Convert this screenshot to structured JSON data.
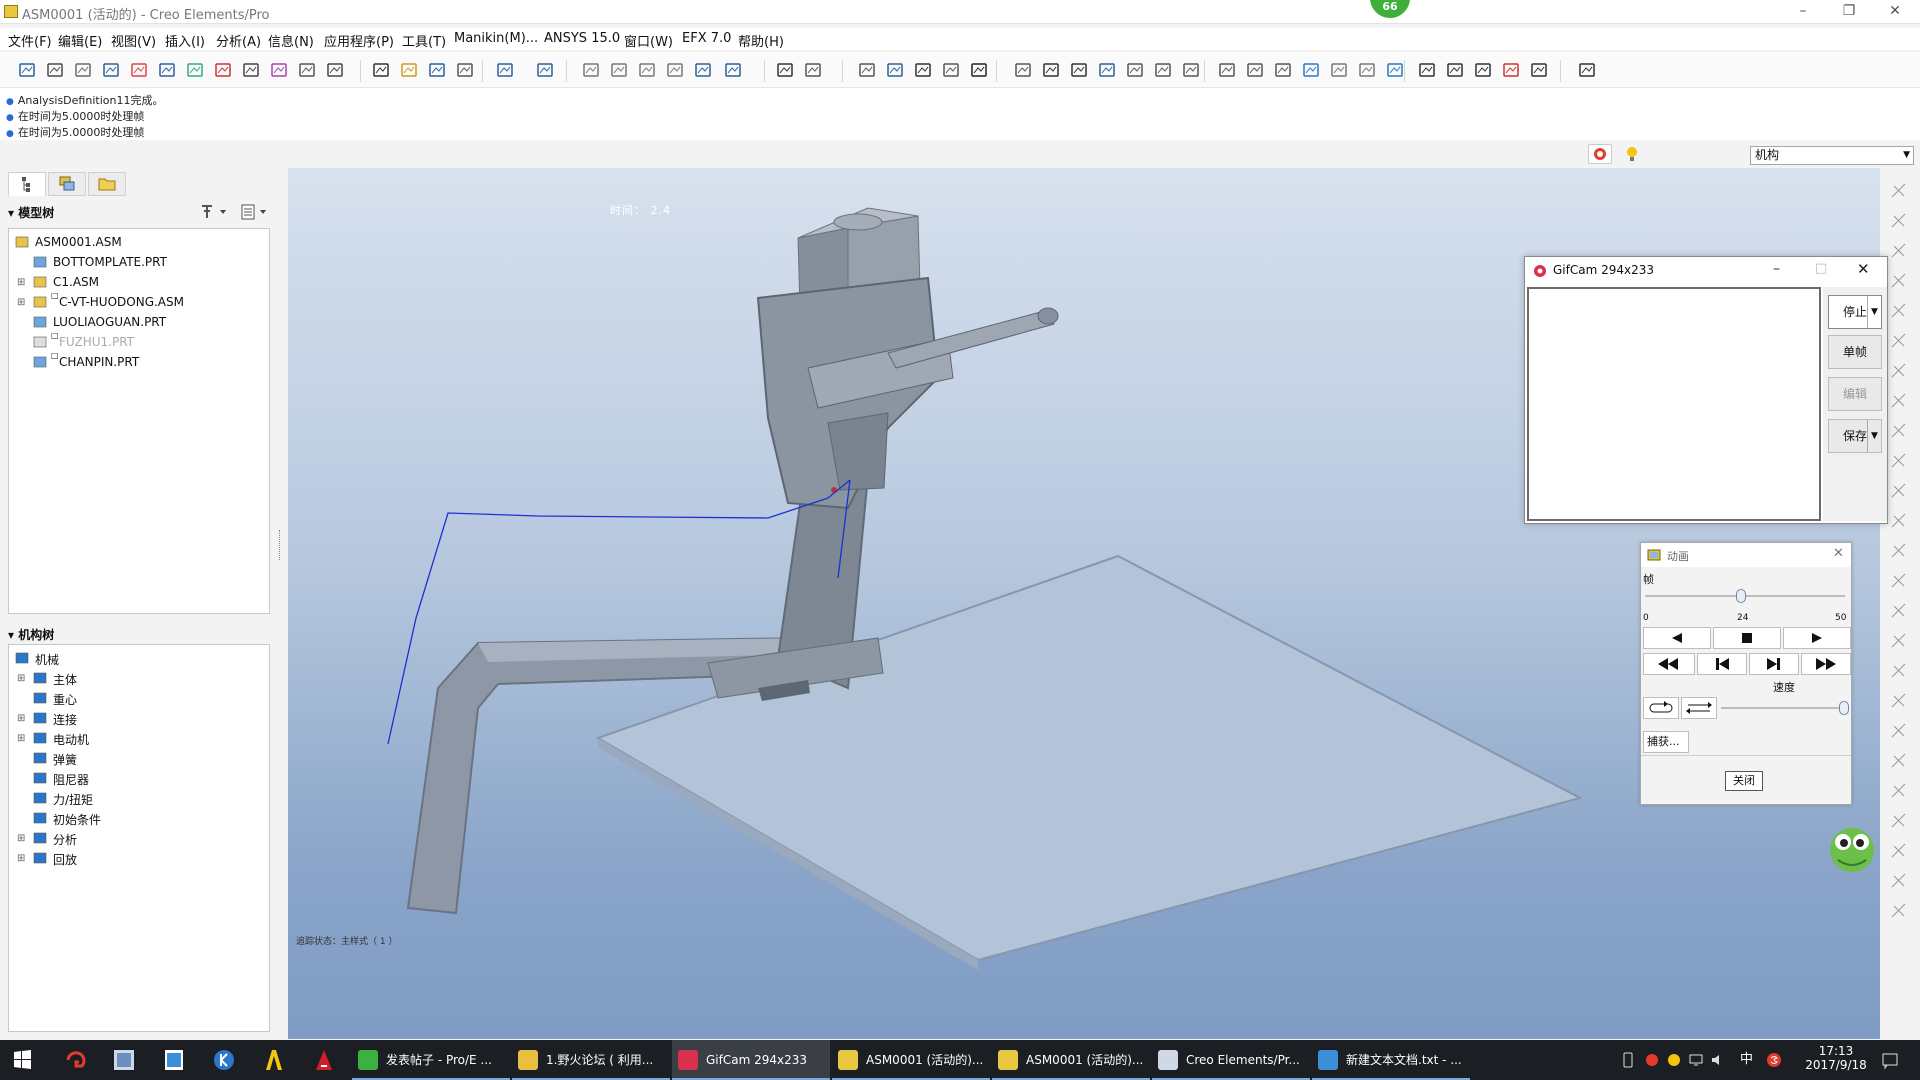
{
  "window": {
    "title": "ASM0001 (活动的) - Creo Elements/Pro",
    "badge": "66"
  },
  "menu": [
    "文件(F)",
    "编辑(E)",
    "视图(V)",
    "插入(I)",
    "分析(A)",
    "信息(N)",
    "应用程序(P)",
    "工具(T)",
    "Manikin(M)...",
    "ANSYS 15.0",
    "窗口(W)",
    "EFX 7.0",
    "帮助(H)"
  ],
  "messages": [
    "AnalysisDefinition11完成。",
    "在时间为5.0000时处理帧",
    "在时间为5.0000时处理帧"
  ],
  "mode_select": "机构",
  "model_tree": {
    "header": "模型树",
    "items": [
      {
        "label": "ASM0001.ASM",
        "icon": "assembly-icon",
        "level": 0,
        "expand": false,
        "dim": false
      },
      {
        "label": "BOTTOMPLATE.PRT",
        "icon": "part-icon",
        "level": 1,
        "expand": false,
        "dim": false
      },
      {
        "label": "C1.ASM",
        "icon": "assembly-icon",
        "level": 1,
        "expand": true,
        "dim": false
      },
      {
        "label": "C-VT-HUODONG.ASM",
        "icon": "assembly-icon",
        "level": 1,
        "expand": true,
        "dim": false,
        "flag": true
      },
      {
        "label": "LUOLIAOGUAN.PRT",
        "icon": "part-icon",
        "level": 1,
        "expand": false,
        "dim": false
      },
      {
        "label": "FUZHU1.PRT",
        "icon": "part-icon",
        "level": 1,
        "expand": false,
        "dim": true,
        "flag": true
      },
      {
        "label": "CHANPIN.PRT",
        "icon": "part-icon",
        "level": 1,
        "expand": false,
        "dim": false,
        "flag": true
      }
    ]
  },
  "mech_tree": {
    "header": "机构树",
    "items": [
      {
        "label": "机械",
        "icon": "mechanism-icon",
        "level": 0,
        "expand": false
      },
      {
        "label": "主体",
        "icon": "body-icon",
        "level": 1,
        "expand": true
      },
      {
        "label": "重心",
        "icon": "gravity-icon",
        "level": 1,
        "expand": false
      },
      {
        "label": "连接",
        "icon": "connection-icon",
        "level": 1,
        "expand": true
      },
      {
        "label": "电动机",
        "icon": "motor-icon",
        "level": 1,
        "expand": true
      },
      {
        "label": "弹簧",
        "icon": "spring-icon",
        "level": 1,
        "expand": false
      },
      {
        "label": "阻尼器",
        "icon": "damper-icon",
        "level": 1,
        "expand": false
      },
      {
        "label": "力/扭矩",
        "icon": "force-icon",
        "level": 1,
        "expand": false
      },
      {
        "label": "初始条件",
        "icon": "initial-condition-icon",
        "level": 1,
        "expand": false
      },
      {
        "label": "分析",
        "icon": "analysis-icon",
        "level": 1,
        "expand": true
      },
      {
        "label": "回放",
        "icon": "playback-icon",
        "level": 1,
        "expand": true
      }
    ]
  },
  "viewport": {
    "time_label": "时间： 2.4",
    "status_label": "追踪状态：主样式（ 1 ）"
  },
  "gifcam": {
    "title": "GifCam 294x233",
    "buttons": [
      "停止",
      "单帧",
      "编辑",
      "保存"
    ]
  },
  "animation": {
    "title": "动画",
    "frame_label": "帧",
    "slider_min": "0",
    "slider_value": "24",
    "slider_max": "50",
    "frame_fraction": 0.48,
    "speed_label": "速度",
    "capture_label": "捕获...",
    "close_label": "关闭"
  },
  "taskbar": {
    "items": [
      {
        "label": "发表帖子 - Pro/E ...",
        "icon_color": "#3cb043"
      },
      {
        "label": "1.野火论坛 ( 利用...",
        "icon_color": "#e8c040"
      },
      {
        "label": "GifCam 294x233",
        "icon_color": "#d9304c",
        "active": true
      },
      {
        "label": "ASM0001 (活动的)...",
        "icon_color": "#e8c840"
      },
      {
        "label": "ASM0001 (活动的)...",
        "icon_color": "#e8c840"
      },
      {
        "label": "Creo Elements/Pr...",
        "icon_color": "#cfd8e6"
      },
      {
        "label": "新建文本文档.txt - ...",
        "icon_color": "#3b8fd9"
      }
    ],
    "ime": "中",
    "time": "17:13",
    "date": "2017/9/18"
  }
}
